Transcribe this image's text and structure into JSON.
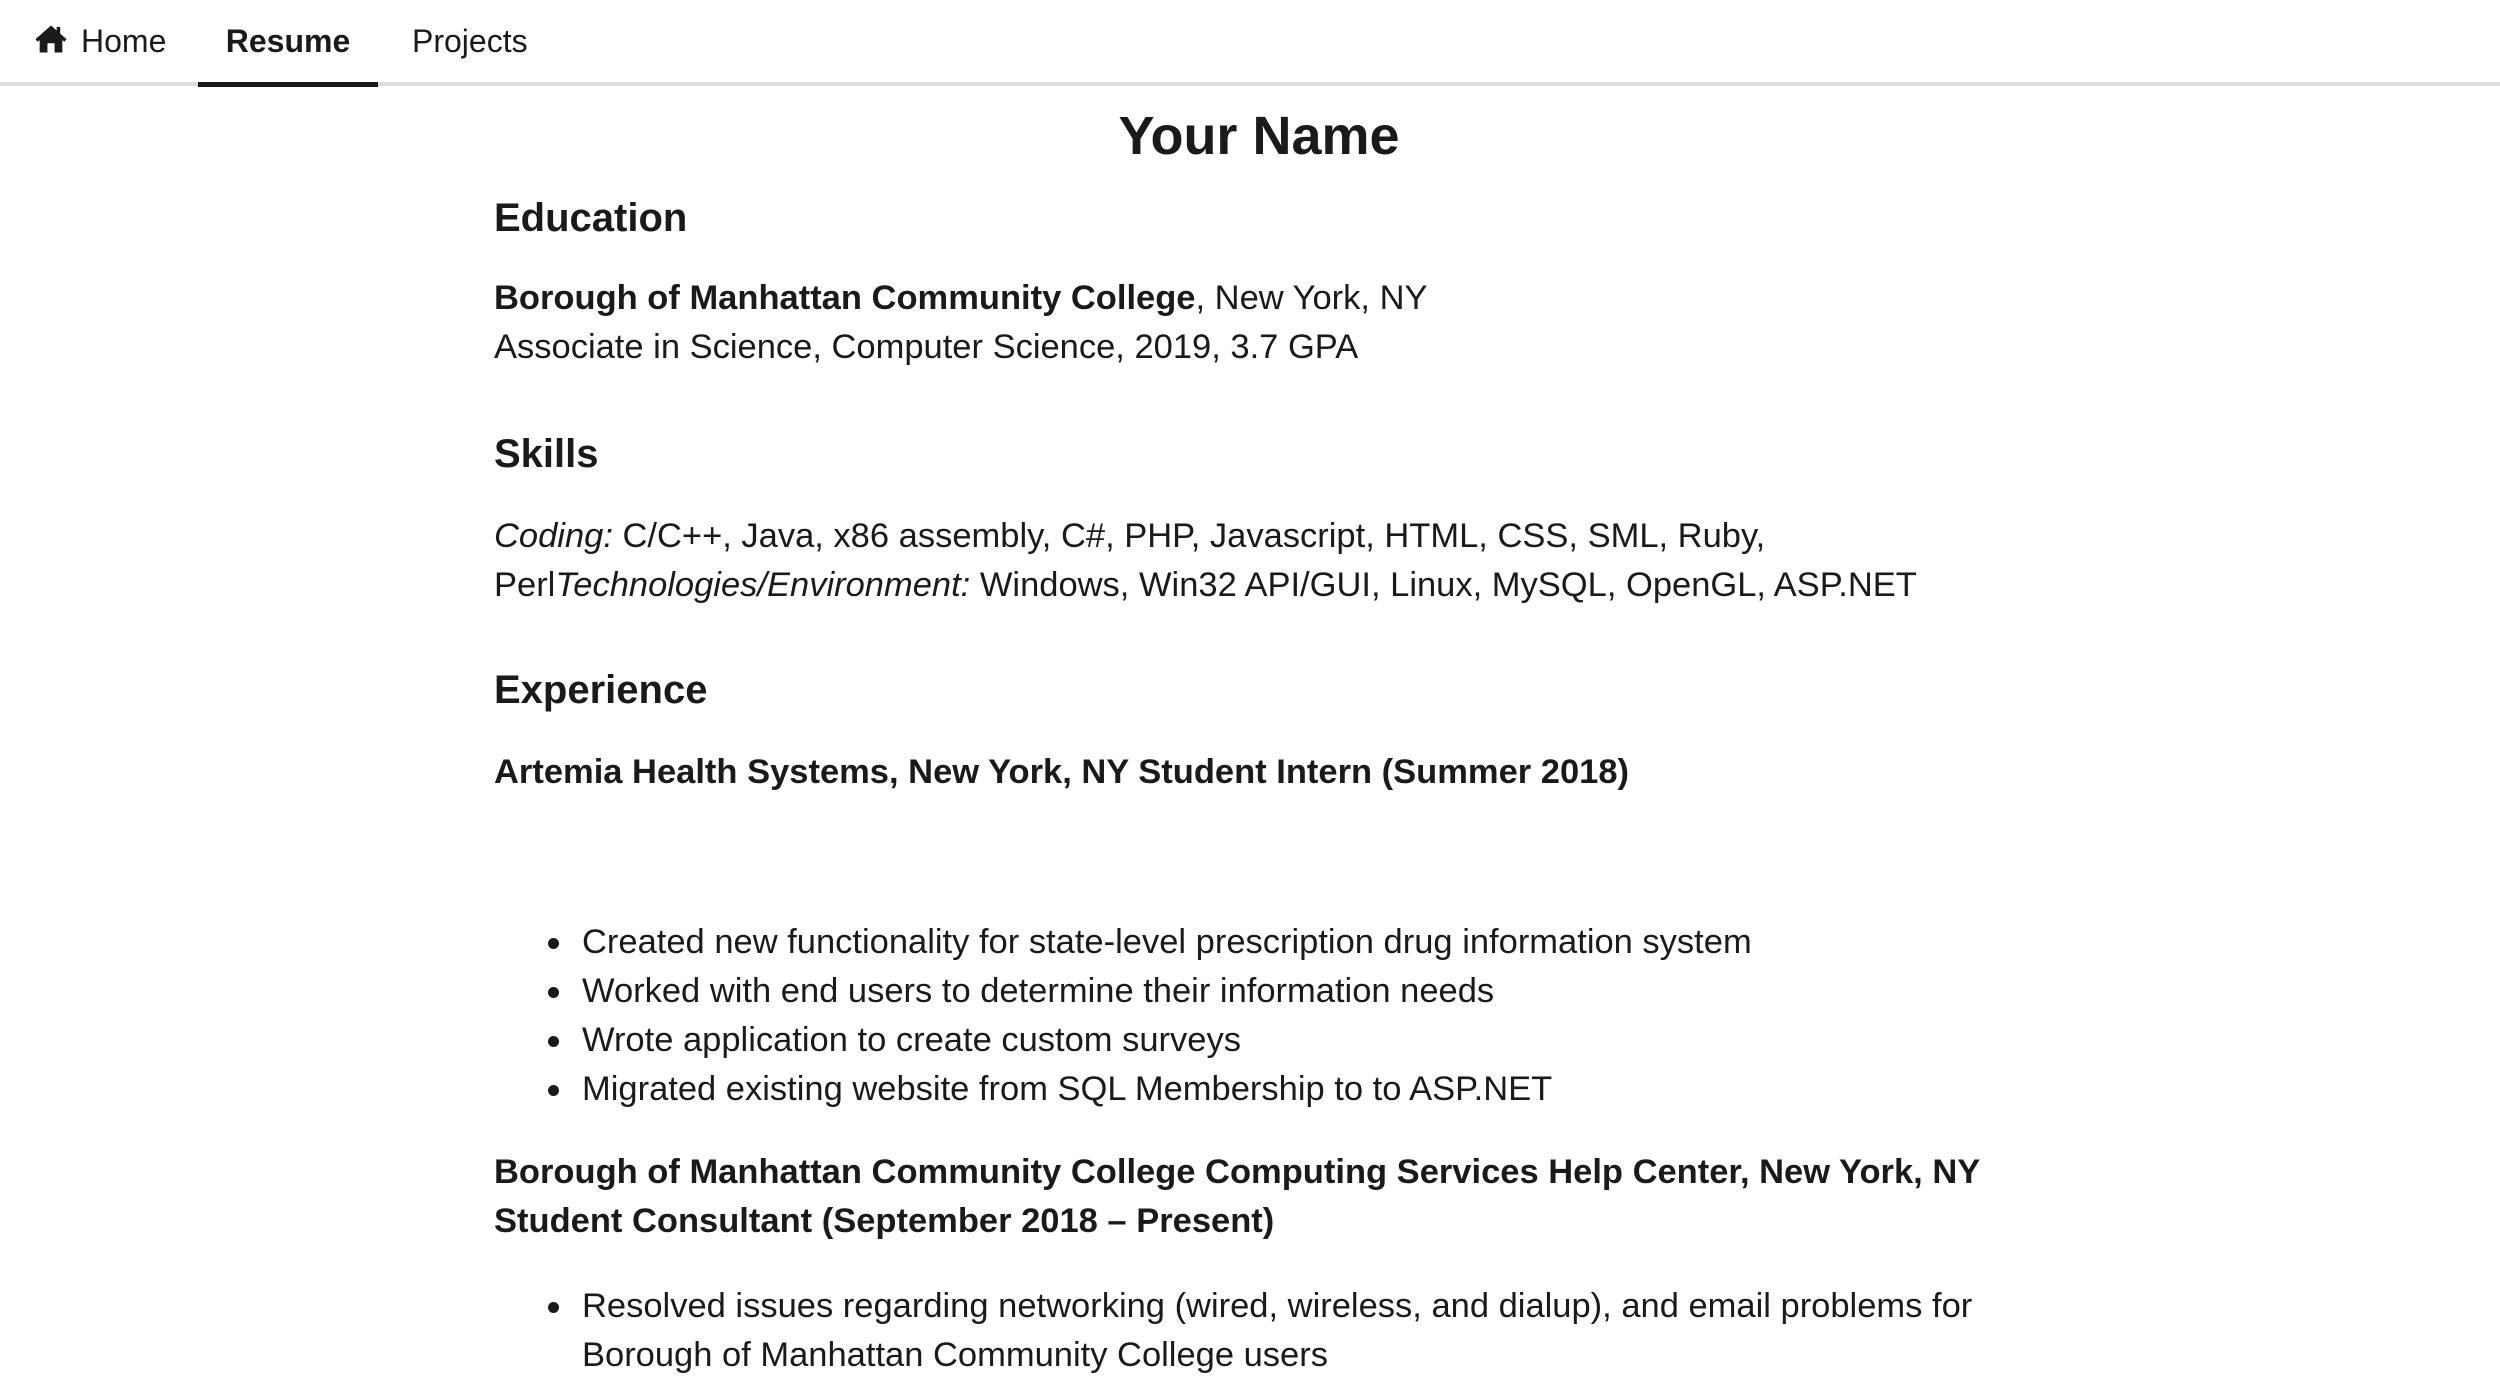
{
  "nav": {
    "home_label": "Home",
    "resume_label": "Resume",
    "projects_label": "Projects"
  },
  "page": {
    "title": "Your Name"
  },
  "education": {
    "heading": "Education",
    "school": "Borough of Manhattan Community College",
    "location": ", New York, NY",
    "degree": "Associate in Science, Computer Science, 2019, 3.7 GPA"
  },
  "skills": {
    "heading": "Skills",
    "coding_label": "Coding:",
    "coding_value": " C/C++, Java, x86 assembly, C#, PHP, Javascript, HTML, CSS, SML, Ruby, Perl",
    "tech_label": "Technologies/Environment:",
    "tech_value": " Windows, Win32 API/GUI, Linux, MySQL, OpenGL, ASP.NET"
  },
  "experience": {
    "heading": "Experience",
    "jobs": [
      {
        "title": "Artemia Health Systems, New York, NY Student Intern (Summer 2018)",
        "bullets": [
          "Created new functionality for state-level prescription drug information system",
          "Worked with end users to determine their information needs",
          "Wrote application to create custom surveys",
          "Migrated existing website from SQL Membership to to ASP.NET"
        ]
      },
      {
        "title": "Borough of Manhattan Community College Computing Services Help Center, New York, NY Student Consultant (September 2018 – Present)",
        "bullets": [
          "Resolved issues regarding networking (wired, wireless, and dialup), and email problems for Borough of Manhattan Community College users"
        ]
      }
    ]
  }
}
